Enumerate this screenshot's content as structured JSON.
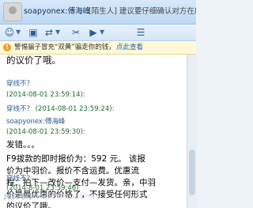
{
  "header": {
    "contact_name": "soapyonex:傅海峰",
    "contact_status": "[陌生人] 建议要仔细确认对方在店里控钱"
  },
  "toolbar": {
    "icons": [
      "emoticon-icon",
      "image-icon",
      "transfer-icon",
      "screenshot-icon",
      "video-icon",
      "menu-icon"
    ]
  },
  "notice": {
    "text": "警惕骗子冒充“双黄”骗走你的钱，",
    "link": "点此查看"
  },
  "messages": [
    {
      "tail": "的议价了哦。"
    },
    {
      "sender": "穿线不？",
      "time": "(2014-08-01 23:59:14):"
    },
    {
      "sender": "穿线不？",
      "time": "(2014-08-01 23:59:24):"
    },
    {
      "sender": "soapyonex:傅海峰",
      "time": "(2014-08-01 23:59:30):",
      "text": "发错。。。"
    },
    {
      "lines": [
        "F9拔款的即时报价为：592 元。 该报",
        "价为中羽价。报价不含运费。优惠流",
        "程：拍下—改价—支付—发货。亲，中羽",
        "价是最优惠的价格了，不接受任何形式",
        "的议价了哦。"
      ]
    },
    {
      "sender": "穿线不？",
      "time": "(2014-8-01 23:59:46)"
    }
  ],
  "watermark": "www.badmintoncn.com",
  "stamp": "2014-8-0"
}
